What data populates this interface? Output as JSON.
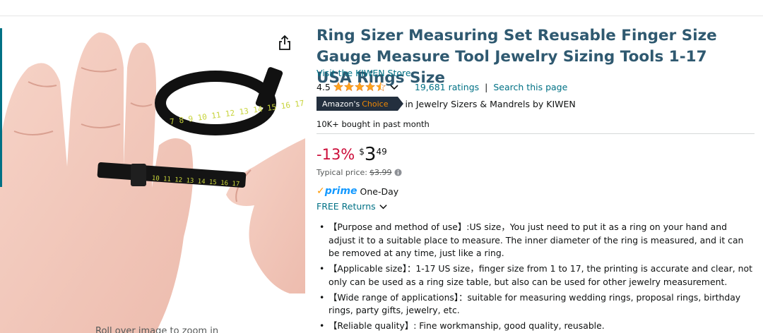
{
  "product": {
    "title": "Ring Sizer Measuring Set Reusable Finger Size Gauge Measure Tool Jewelry Sizing Tools 1-17 USA Rings Size",
    "store_link": "Visit the KIWEN Store",
    "rating": "4.5",
    "rating_stars": 4.5,
    "ratings_count": "19,681 ratings",
    "separator": "|",
    "search_page": "Search this page",
    "badge_left": "Amazon's",
    "badge_right": "Choice",
    "badge_category": "in Jewelry Sizers & Mandrels by KIWEN",
    "bought": "10K+ bought in past month",
    "image_hint": "Roll over image to zoom in",
    "image_scale_numbers": "7 8 9 10 11 12 13 14 15 16 17"
  },
  "price": {
    "discount": "-13%",
    "currency": "$",
    "whole": "3",
    "fraction": "49",
    "typical_label": "Typical price:",
    "typical_value": "$3.99"
  },
  "delivery": {
    "prime_check": "✓",
    "prime_word": "prime",
    "prime_speed": "One-Day",
    "returns": "FREE Returns"
  },
  "bullets": [
    "【Purpose and method of use】:US size，You just need to put it as a ring on your hand and adjust it to a suitable place to measure. The inner diameter of the ring is measured, and it can be removed at any time, just like a ring.",
    "【Applicable size】：1-17 US size，finger size from 1 to 17, the printing is accurate and clear, not only can be used as a ring size table, but also can be used for other jewelry measurement.",
    "【Wide range of applications】：suitable for measuring wedding rings, proposal rings, birthday rings, party gifts, jewelry, etc.",
    "【Reliable quality】: Fine workmanship, good quality, reusable."
  ],
  "colors": {
    "title": "#2f5970",
    "link": "#007185",
    "discount": "#cc0c39",
    "star": "#ffa41c",
    "prime": "#1399ff",
    "badge_bg": "#232f3e",
    "badge_accent": "#f08804"
  },
  "icons": {
    "share": "share-icon",
    "star": "star-icon",
    "chevron": "chevron-down-icon",
    "info": "info-icon",
    "prime_check": "check-icon"
  }
}
